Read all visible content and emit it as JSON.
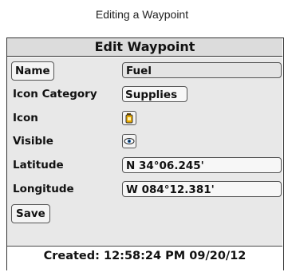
{
  "caption": "Editing a Waypoint",
  "dialog": {
    "title": "Edit Waypoint",
    "fields": {
      "name_label": "Name",
      "name_value": "Fuel",
      "icon_category_label": "Icon Category",
      "icon_category_value": "Supplies",
      "icon_label": "Icon",
      "icon_value": "fuel-can-icon",
      "visible_label": "Visible",
      "visible_value": "eye-icon",
      "latitude_label": "Latitude",
      "latitude_value": "N 34°06.245'",
      "longitude_label": "Longitude",
      "longitude_value": "W 084°12.381'"
    },
    "save_label": "Save",
    "footer": "Created: 12:58:24 PM 09/20/12"
  }
}
